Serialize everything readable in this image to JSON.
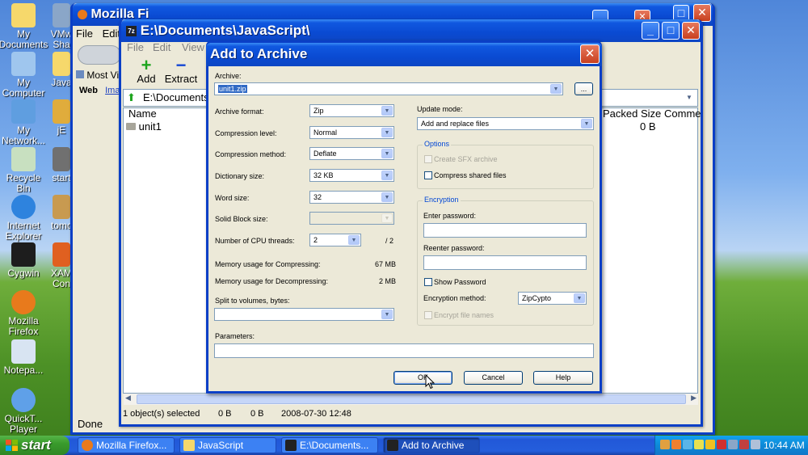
{
  "desktop": {
    "icons_col1": [
      {
        "label": "My Documents",
        "color": "#f6d86b"
      },
      {
        "label": "My Computer",
        "color": "#9fc6ee"
      },
      {
        "label": "My Network...",
        "color": "#5f9ee0"
      },
      {
        "label": "Recycle Bin",
        "color": "#c8e0c0"
      },
      {
        "label": "Internet Explorer",
        "color": "#2e83de"
      },
      {
        "label": "Cygwin",
        "color": "#1d1d1d"
      },
      {
        "label": "Mozilla Firefox",
        "color": "#e87a1c"
      },
      {
        "label": "Notepa...",
        "color": "#d8e4f2"
      },
      {
        "label": "QuickT... Player",
        "color": "#5fa0e8"
      }
    ],
    "icons_col2": [
      {
        "label": "VMw Sha",
        "color": "#8aa6c8"
      },
      {
        "label": "Java",
        "color": "#f6d86b"
      },
      {
        "label": "jE",
        "color": "#e0ac3c"
      },
      {
        "label": "start",
        "color": "#707070"
      },
      {
        "label": "tomc",
        "color": "#c89a50"
      },
      {
        "label": "XAM Con",
        "color": "#e06020"
      }
    ]
  },
  "firefox_window": {
    "title": "Mozilla Fi",
    "menu_file": "File",
    "menu_edit": "Edit",
    "bookmarks_label": "Most Vi",
    "tab_web": "Web",
    "tab_images": "Ima",
    "status": "Done"
  },
  "sevenzip_window": {
    "title": "E:\\Documents\\JavaScript\\",
    "menu": [
      "File",
      "Edit",
      "View"
    ],
    "toolbar_add": "Add",
    "toolbar_extract": "Extract",
    "address": "E:\\Documents",
    "columns": {
      "name": "Name",
      "packed_size": "Packed Size",
      "comment": "Comme"
    },
    "row": {
      "name": "unit1",
      "packed_size": "0 B"
    },
    "status": [
      "1 object(s) selected",
      "0 B",
      "0 B",
      "2008-07-30 12:48"
    ]
  },
  "dialog": {
    "title": "Add to Archive",
    "archive_label": "Archive:",
    "archive_value": "unit1.zip",
    "browse_label": "...",
    "archive_format_label": "Archive format:",
    "archive_format_value": "Zip",
    "compression_level_label": "Compression level:",
    "compression_level_value": "Normal",
    "compression_method_label": "Compression method:",
    "compression_method_value": "Deflate",
    "dictionary_size_label": "Dictionary size:",
    "dictionary_size_value": "32 KB",
    "word_size_label": "Word size:",
    "word_size_value": "32",
    "solid_block_label": "Solid Block size:",
    "cpu_threads_label": "Number of CPU threads:",
    "cpu_threads_value": "2",
    "cpu_threads_max": "/ 2",
    "mem_compress_label": "Memory usage for Compressing:",
    "mem_compress_value": "67 MB",
    "mem_decompress_label": "Memory usage for Decompressing:",
    "mem_decompress_value": "2 MB",
    "split_label": "Split to volumes, bytes:",
    "parameters_label": "Parameters:",
    "update_mode_label": "Update mode:",
    "update_mode_value": "Add and replace files",
    "options_title": "Options",
    "create_sfx_label": "Create SFX archive",
    "compress_shared_label": "Compress shared files",
    "encryption_title": "Encryption",
    "enter_password_label": "Enter password:",
    "reenter_password_label": "Reenter password:",
    "show_password_label": "Show Password",
    "encryption_method_label": "Encryption method:",
    "encryption_method_value": "ZipCypto",
    "encrypt_names_label": "Encrypt file names",
    "ok_label": "OK",
    "cancel_label": "Cancel",
    "help_label": "Help"
  },
  "taskbar": {
    "start_label": "start",
    "buttons": [
      "Mozilla Firefox...",
      "JavaScript",
      "E:\\Documents...",
      "Add to Archive"
    ],
    "clock": "10:44 AM"
  }
}
